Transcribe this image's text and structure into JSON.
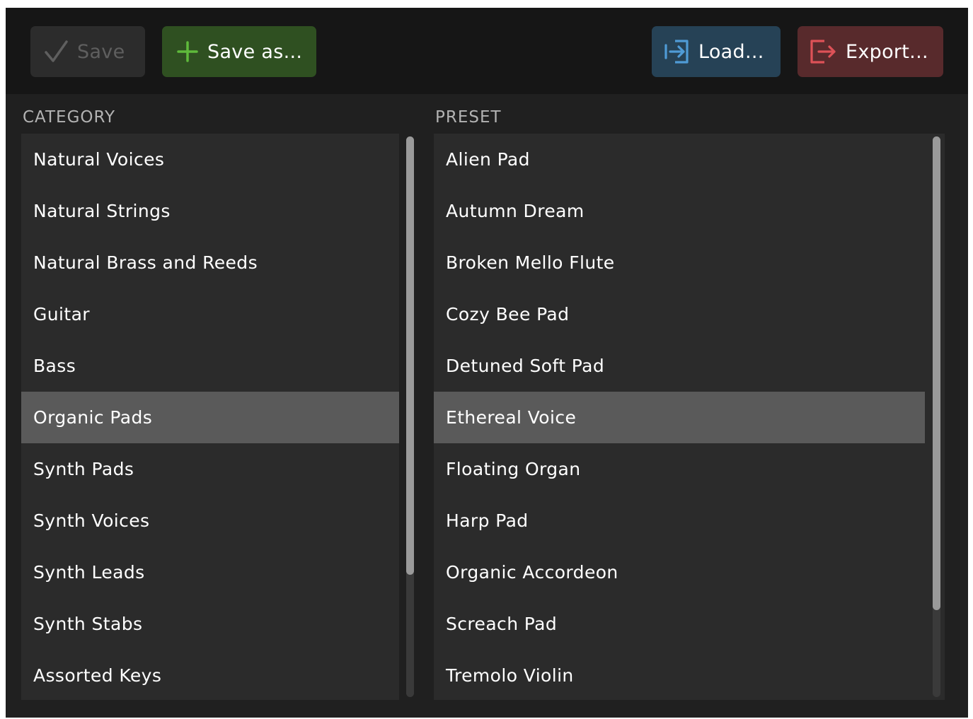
{
  "toolbar": {
    "save_label": "Save",
    "save_as_label": "Save as...",
    "load_label": "Load...",
    "export_label": "Export..."
  },
  "icons": {
    "save": "checkmark-icon",
    "save_as": "plus-icon",
    "load": "load-icon",
    "export": "export-icon"
  },
  "colors": {
    "save_as_accent": "#5fba3b",
    "load_accent": "#4f9bd6",
    "export_accent": "#dd5257"
  },
  "category": {
    "header": "CATEGORY",
    "selected_index": 5,
    "items": [
      "Natural Voices",
      "Natural Strings",
      "Natural Brass and Reeds",
      "Guitar",
      "Bass",
      "Organic Pads",
      "Synth Pads",
      "Synth Voices",
      "Synth Leads",
      "Synth Stabs",
      "Assorted Keys"
    ]
  },
  "preset": {
    "header": "PRESET",
    "selected_index": 5,
    "items": [
      "Alien Pad",
      "Autumn Dream",
      "Broken Mello Flute",
      "Cozy Bee Pad",
      "Detuned Soft Pad",
      "Ethereal Voice",
      "Floating Organ",
      "Harp Pad",
      "Organic Accordeon",
      "Screach Pad",
      "Tremolo Violin"
    ]
  }
}
